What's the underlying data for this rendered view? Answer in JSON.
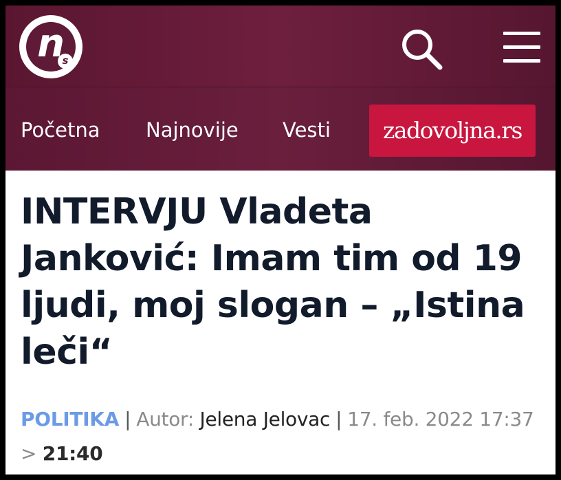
{
  "header": {
    "logo": {
      "letter": "n",
      "sub_letter": "s"
    },
    "search_icon": "search-icon",
    "menu_icon": "hamburger-menu-icon"
  },
  "nav": {
    "items": [
      {
        "label": "Početna"
      },
      {
        "label": "Najnovije"
      },
      {
        "label": "Vesti"
      }
    ],
    "brand_label": "zadovoljna.rs",
    "brand_color": "#c8163f"
  },
  "article": {
    "headline": "INTERVJU Vladeta Janković: Imam tim od 19 ljudi, moj slogan – „Istina leči“",
    "category": "POLITIKA",
    "author_prefix": "Autor:",
    "author": "Jelena Jelovac",
    "published": "17. feb. 2022 17:37",
    "arrow": ">",
    "updated": "21:40"
  },
  "colors": {
    "header_bg": "#6a1f3d",
    "headline": "#121b2b",
    "category": "#6c9be6"
  }
}
